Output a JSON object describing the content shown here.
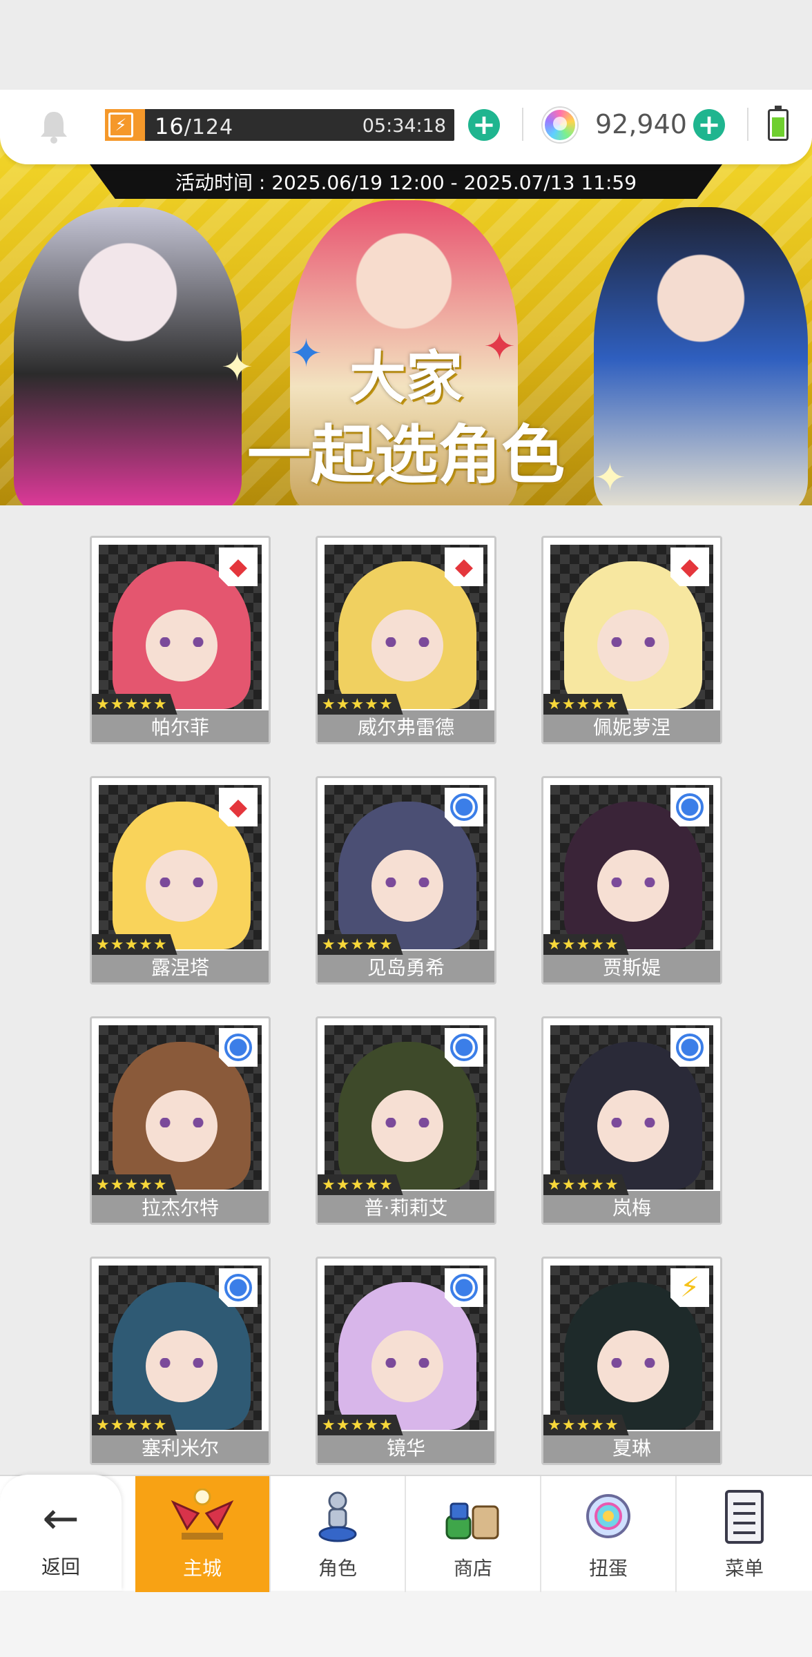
{
  "status_bar": {
    "stamina_icon": "lightning-icon",
    "stamina_current": "16",
    "stamina_max": "/124",
    "stamina_timer": "05:34:18",
    "gem_count": "92,940",
    "accent_green": "#1fb58f",
    "accent_orange": "#f5982a"
  },
  "banner": {
    "event_time": "活动时间 : 2025.06/19 12:00 - 2025.07/13 11:59",
    "title_line1": "大家",
    "title_line2": "一起选角色"
  },
  "characters": [
    {
      "name": "帕尔菲",
      "stars": "★★★★★",
      "element": "red-diamond-icon",
      "hair": "#e4566f"
    },
    {
      "name": "威尔弗雷德",
      "stars": "★★★★★",
      "element": "red-diamond-icon",
      "hair": "#f0d060"
    },
    {
      "name": "佩妮萝涅",
      "stars": "★★★★★",
      "element": "red-diamond-icon",
      "hair": "#f7e7a0"
    },
    {
      "name": "露涅塔",
      "stars": "★★★★★",
      "element": "red-diamond-icon",
      "hair": "#f9d35a"
    },
    {
      "name": "见岛勇希",
      "stars": "★★★★★",
      "element": "blue-circle-icon",
      "hair": "#4b4f74"
    },
    {
      "name": "贾斯媞",
      "stars": "★★★★★",
      "element": "blue-circle-icon",
      "hair": "#3a2438"
    },
    {
      "name": "拉杰尔特",
      "stars": "★★★★★",
      "element": "blue-circle-icon",
      "hair": "#8a5a3a"
    },
    {
      "name": "普·莉莉艾",
      "stars": "★★★★★",
      "element": "blue-circle-icon",
      "hair": "#3e4a2a"
    },
    {
      "name": "岚梅",
      "stars": "★★★★★",
      "element": "blue-circle-icon",
      "hair": "#2a2a38"
    },
    {
      "name": "塞利米尔",
      "stars": "★★★★★",
      "element": "blue-circle-icon",
      "hair": "#2f5a74"
    },
    {
      "name": "镜华",
      "stars": "★★★★★",
      "element": "blue-circle-icon",
      "hair": "#d8b6ea"
    },
    {
      "name": "夏琳",
      "stars": "★★★★★",
      "element": "lightning-icon",
      "hair": "#1e2a2a"
    }
  ],
  "bottom_nav": {
    "back_label": "返回",
    "items": [
      {
        "label": "主城",
        "icon": "castle-icon"
      },
      {
        "label": "角色",
        "icon": "character-icon"
      },
      {
        "label": "商店",
        "icon": "shop-icon"
      },
      {
        "label": "扭蛋",
        "icon": "gacha-icon"
      },
      {
        "label": "菜单",
        "icon": "menu-list-icon"
      }
    ]
  }
}
